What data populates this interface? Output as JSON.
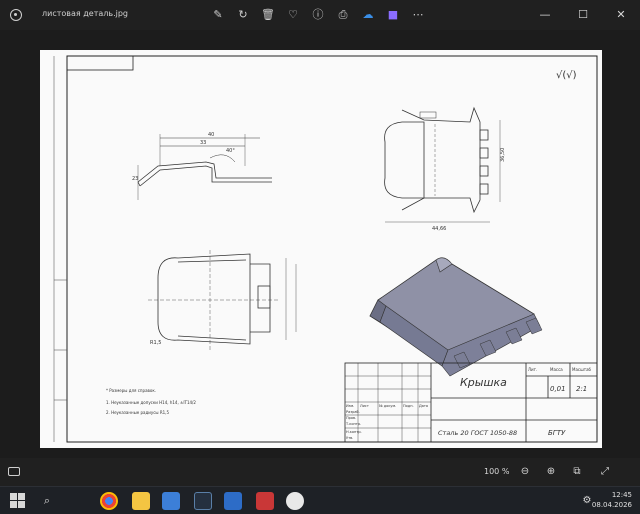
{
  "window": {
    "filename": "листовая деталь.jpg",
    "tools": [
      "edit-icon",
      "rotate-icon",
      "delete-icon",
      "favorite-icon",
      "info-icon",
      "print-icon",
      "onedrive-icon",
      "clipchamp-icon",
      "more-icon"
    ],
    "controls": [
      "minimize",
      "maximize",
      "close"
    ]
  },
  "drawing": {
    "title": "Крышка",
    "material": "Сталь 20 ГОСТ 1050-88",
    "organization": "БГТУ",
    "mass": "0,01",
    "scale": "2:1",
    "roughness": "√(√)",
    "notes": [
      "* Размеры для справок.",
      "1.  Неуказанные допуски Н14, h14, ±IT14/2",
      "2.  Неуказанные радиусы R1,5"
    ],
    "titleblock_rows": [
      "Изм.",
      "Разраб.",
      "Пров.",
      "Т.контр.",
      "Н.контр.",
      "Утв."
    ],
    "titleblock_head": [
      "Лист",
      "№ докум.",
      "Подп.",
      "Дата"
    ],
    "titleblock_cols": [
      "Лит.",
      "Масса",
      "Масштаб"
    ],
    "dims": {
      "top_width": "40",
      "inner": "33",
      "plan_height": "36,50",
      "plan_width": "44,66",
      "angle": "40°",
      "radius": "R1,5",
      "front_height": "23"
    }
  },
  "zoom": {
    "level": "100 %"
  },
  "taskbar": {
    "apps": [
      "search",
      "chrome",
      "explorer",
      "files",
      "terminal",
      "kompas",
      "acrobat",
      "camera"
    ],
    "time": "12:45",
    "date": "08.04.2026"
  }
}
